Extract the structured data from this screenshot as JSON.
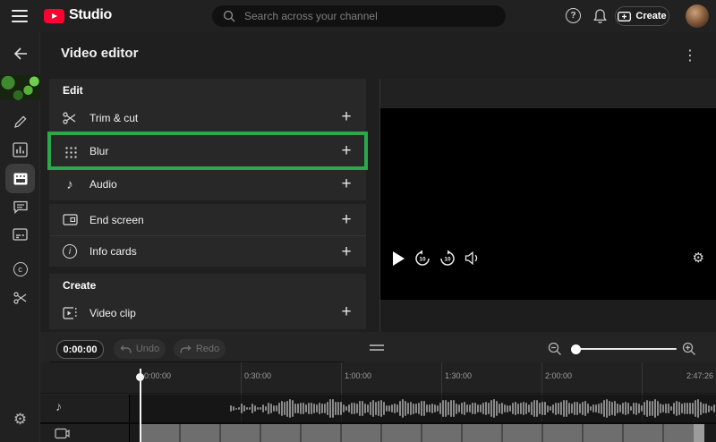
{
  "topbar": {
    "logo_text": "Studio",
    "search_placeholder": "Search across your channel",
    "create_label": "Create"
  },
  "header": {
    "title": "Video editor"
  },
  "sidebar": {
    "icons": [
      "back-arrow",
      "video-thumbnail",
      "details-pencil",
      "analytics-chart",
      "editor-active",
      "comments",
      "subtitles",
      "copyright",
      "trim-scissors",
      "settings-gear"
    ]
  },
  "edit_panel": {
    "highlight_color": "#2ba84a",
    "sections": [
      {
        "title": "Edit",
        "items": [
          {
            "label": "Trim & cut",
            "icon": "scissors-icon"
          },
          {
            "label": "Blur",
            "icon": "blur-grid-icon",
            "highlighted": true
          },
          {
            "label": "Audio",
            "icon": "music-note-icon"
          },
          {
            "label": "End screen",
            "icon": "end-screen-icon"
          },
          {
            "label": "Info cards",
            "icon": "info-icon"
          }
        ]
      },
      {
        "title": "Create",
        "items": [
          {
            "label": "Video clip",
            "icon": "video-clip-icon"
          }
        ]
      }
    ]
  },
  "player": {
    "controls": [
      "play",
      "rewind-10",
      "forward-10",
      "volume",
      "settings"
    ],
    "skip_amount": "10"
  },
  "timeline": {
    "current_time": "0:00:00",
    "undo_label": "Undo",
    "redo_label": "Redo",
    "ruler": {
      "ticks": [
        "0:00:00",
        "0:30:00",
        "1:00:00",
        "1:30:00",
        "2:00:00"
      ],
      "end_label": "2:47:26"
    },
    "tracks": [
      {
        "type": "audio"
      },
      {
        "type": "video"
      }
    ]
  },
  "glyphs": {
    "kebab": "⋮",
    "plus": "+",
    "gear": "⚙",
    "music_note": "♪",
    "question": "?",
    "copyright": "c",
    "info": "i"
  },
  "colors": {
    "accent_green": "#2ba84a",
    "youtube_red": "#ff0033",
    "background": "#1f1f1f"
  }
}
